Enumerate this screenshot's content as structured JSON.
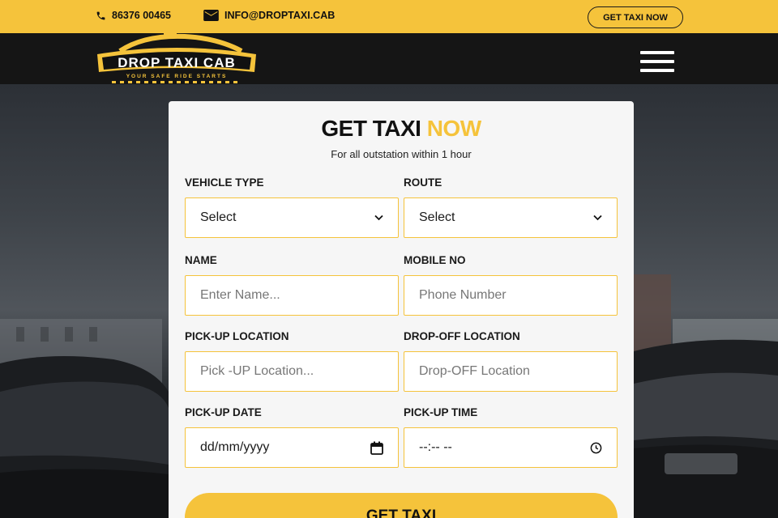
{
  "topbar": {
    "phone": "86376 00465",
    "email": "INFO@DROPTAXI.CAB",
    "cta_label": "GET TAXI NOW"
  },
  "navbar": {
    "logo_title": "DROP TAXI CAB",
    "logo_tagline": "YOUR SAFE RIDE STARTS",
    "menu_icon": "hamburger-icon"
  },
  "form": {
    "title_main": "GET TAXI",
    "title_accent": "NOW",
    "subtitle": "For all outstation within 1 hour",
    "vehicle_type": {
      "label": "VEHICLE TYPE",
      "value": "Select"
    },
    "route": {
      "label": "ROUTE",
      "value": "Select"
    },
    "name": {
      "label": "NAME",
      "placeholder": "Enter Name..."
    },
    "mobile": {
      "label": "MOBILE NO",
      "placeholder": "Phone Number"
    },
    "pickup_location": {
      "label": "PICK-UP LOCATION",
      "placeholder": "Pick -UP Location..."
    },
    "dropoff_location": {
      "label": "DROP-OFF LOCATION",
      "placeholder": "Drop-OFF Location"
    },
    "pickup_date": {
      "label": "PICK-UP DATE",
      "value": "dd/mm/yyyy"
    },
    "pickup_time": {
      "label": "PICK-UP TIME",
      "value": "--:-- --"
    },
    "submit_label": "GET TAXI"
  },
  "colors": {
    "accent": "#f5c33b",
    "dark": "#151515"
  }
}
